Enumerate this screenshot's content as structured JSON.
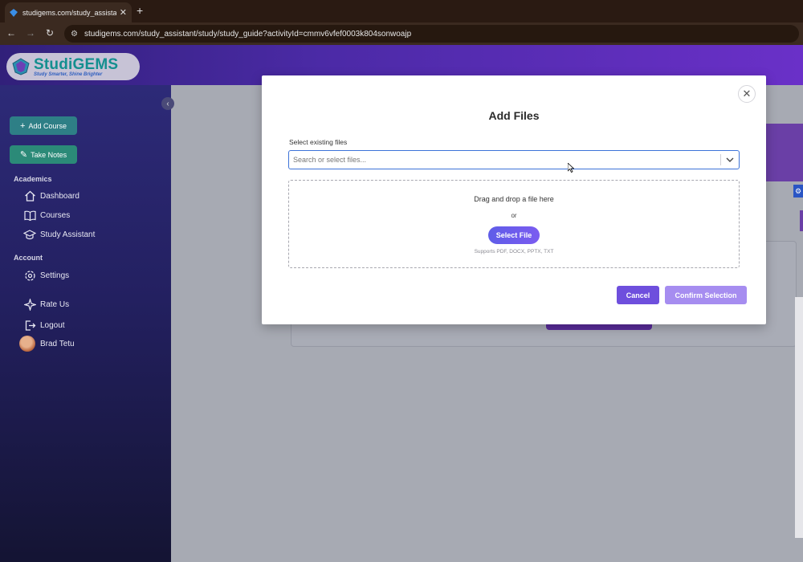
{
  "browser": {
    "tab_title": "studigems.com/study_assistant",
    "tab_close": "✕",
    "new_tab": "+",
    "url": "studigems.com/study_assistant/study/study_guide?activityId=cmmv6vfef0003k804sonwoajp"
  },
  "app": {
    "brand": "StudiGEMS",
    "tagline": "Study Smarter, Shine Brighter"
  },
  "sidebar": {
    "add_course": "Add Course",
    "take_notes": "Take Notes",
    "section_academics": "Academics",
    "section_account": "Account",
    "items": [
      {
        "label": "Dashboard",
        "icon": "home-icon"
      },
      {
        "label": "Courses",
        "icon": "book-icon"
      },
      {
        "label": "Study Assistant",
        "icon": "graduation-cap-icon"
      },
      {
        "label": "Settings",
        "icon": "gear-icon"
      },
      {
        "label": "Rate Us",
        "icon": "sparkle-icon"
      },
      {
        "label": "Logout",
        "icon": "logout-icon"
      },
      {
        "label": "Brad Tetu",
        "icon": "avatar"
      }
    ]
  },
  "modal": {
    "title": "Add Files",
    "field_label": "Select existing files",
    "search_placeholder": "Search or select files...",
    "dropzone_text": "Drag and drop a file here",
    "or_text": "or",
    "select_file": "Select File",
    "supports": "Supports PDF, DOCX, PPTX, TXT",
    "cancel": "Cancel",
    "confirm": "Confirm Selection"
  },
  "colors": {
    "accent": "#6e4fdd",
    "teal": "#2f8a86",
    "focus_border": "#3d73d8"
  }
}
